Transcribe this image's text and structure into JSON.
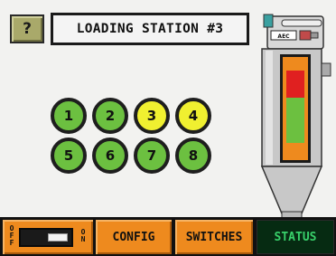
{
  "header": {
    "help_label": "?",
    "title": "LOADING STATION #3"
  },
  "stations": [
    {
      "label": "1",
      "state": "green"
    },
    {
      "label": "2",
      "state": "green"
    },
    {
      "label": "3",
      "state": "yellow"
    },
    {
      "label": "4",
      "state": "yellow"
    },
    {
      "label": "5",
      "state": "green"
    },
    {
      "label": "6",
      "state": "green"
    },
    {
      "label": "7",
      "state": "green"
    },
    {
      "label": "8",
      "state": "green"
    }
  ],
  "loader": {
    "brand_text": "AEC",
    "level_indicator_colors": [
      "#e02020",
      "#6cc040"
    ]
  },
  "toolbar": {
    "off_label": "OFF",
    "on_label": "ON",
    "config_label": "CONFIG",
    "switches_label": "SWITCHES",
    "status_label": "STATUS"
  },
  "colors": {
    "station_active": "#6cc040",
    "station_highlight": "#f0f030",
    "button_orange": "#ee8a1e",
    "status_text": "#38d06a"
  }
}
